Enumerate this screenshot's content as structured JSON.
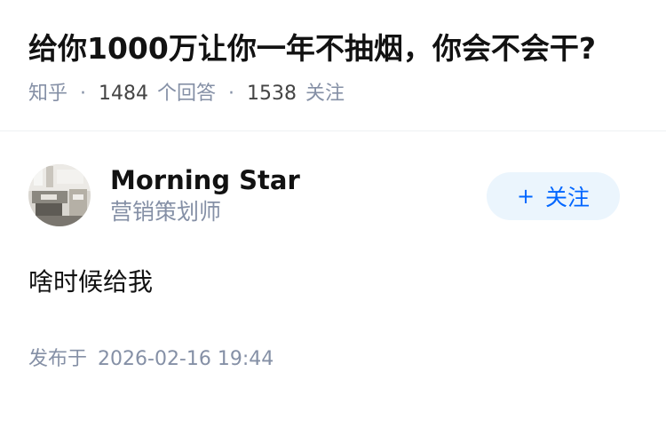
{
  "question": {
    "title": "给你1000万让你一年不抽烟，你会不会干?",
    "source": "知乎",
    "answer_count": "1484",
    "answer_label": "个回答",
    "follower_count": "1538",
    "follower_label": "关注",
    "separator": "·"
  },
  "answer": {
    "author": {
      "name": "Morning Star",
      "bio": "营销策划师",
      "avatar_icon": "user-avatar-photo"
    },
    "follow_button": {
      "icon": "+",
      "label": "关注",
      "color": "#0066ff",
      "background": "#ebf5fd"
    },
    "content": "啥时候给我",
    "published_label": "发布于",
    "published_time": "2026-02-16 19:44"
  }
}
